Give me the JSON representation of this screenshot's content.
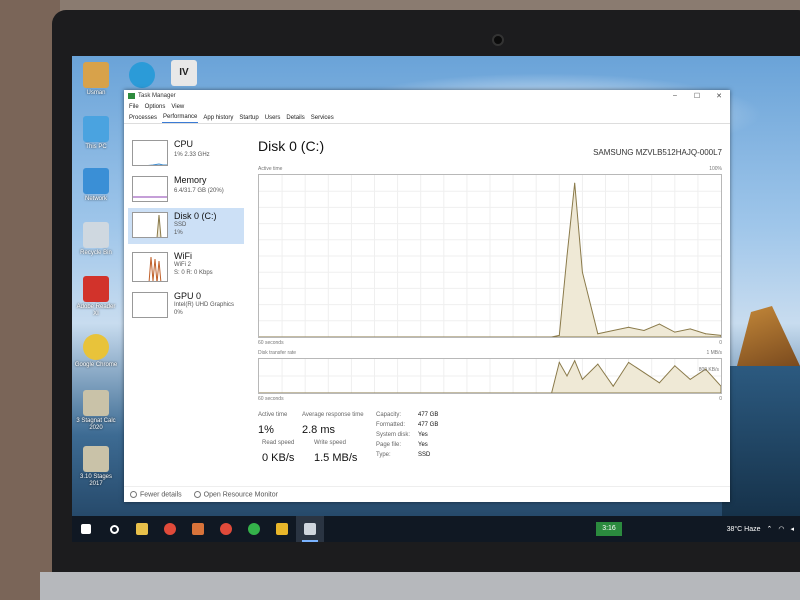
{
  "window": {
    "title": "Task Manager",
    "controls": [
      "–",
      "☐",
      "✕"
    ]
  },
  "menu": [
    "File",
    "Options",
    "View"
  ],
  "tabs": [
    "Processes",
    "Performance",
    "App history",
    "Startup",
    "Users",
    "Details",
    "Services"
  ],
  "active_tab": "Performance",
  "sidebar": {
    "items": [
      {
        "name": "CPU",
        "sub1": "1% 2.33 GHz",
        "sub2": ""
      },
      {
        "name": "Memory",
        "sub1": "6.4/31.7 GB (20%)",
        "sub2": ""
      },
      {
        "name": "Disk 0 (C:)",
        "sub1": "SSD",
        "sub2": "1%"
      },
      {
        "name": "WiFi",
        "sub1": "WiFi 2",
        "sub2": "S: 0 R: 0 Kbps"
      },
      {
        "name": "GPU 0",
        "sub1": "Intel(R) UHD Graphics",
        "sub2": "0%"
      }
    ],
    "selected": "Disk 0 (C:)"
  },
  "main": {
    "title": "Disk 0 (C:)",
    "model": "SAMSUNG MZVLB512HAJQ-000L7",
    "graph1_label": "Active time",
    "graph1_max": "100%",
    "graph1_time": "60 seconds",
    "graph1_min": "0",
    "graph2_label": "Disk transfer rate",
    "graph2_max": "1 MB/s",
    "graph2_mid": "800 KB/s",
    "graph2_time": "60 seconds",
    "graph2_min": "0",
    "stats": {
      "active_time_label": "Active time",
      "active_time_value": "1%",
      "avg_response_label": "Average response time",
      "avg_response_value": "2.8 ms",
      "read_speed_label": "Read speed",
      "read_speed_value": "0 KB/s",
      "write_speed_label": "Write speed",
      "write_speed_value": "1.5 MB/s"
    },
    "info": [
      {
        "label": "Capacity:",
        "value": "477 GB"
      },
      {
        "label": "Formatted:",
        "value": "477 GB"
      },
      {
        "label": "System disk:",
        "value": "Yes"
      },
      {
        "label": "Page file:",
        "value": "Yes"
      },
      {
        "label": "Type:",
        "value": "SSD"
      }
    ]
  },
  "footer": {
    "fewer_details": "Fewer details",
    "open_monitor": "Open Resource Monitor"
  },
  "desktop_icons": [
    {
      "label": "Usman",
      "color": "#d8a24a"
    },
    {
      "label": "This PC",
      "color": "#4aa3e0"
    },
    {
      "label": "Network",
      "color": "#3a8fd6"
    },
    {
      "label": "Recycle Bin",
      "color": "#cfd8e0"
    },
    {
      "label": "Adobe Reader XI",
      "color": "#d2332b"
    },
    {
      "label": "Google Chrome",
      "color": "#e8c33a"
    },
    {
      "label": "3 Stagnat Calc 2020",
      "color": "#c9c2a8"
    },
    {
      "label": "3.10 Stages 2017",
      "color": "#c9c2a8"
    },
    {
      "label": "Microsoft Edge",
      "color": "#2b9bd8"
    },
    {
      "label": "IV",
      "color": "#e8e8e8"
    }
  ],
  "taskbar": {
    "clock": "3:16",
    "weather": "38°C  Haze",
    "icons": [
      "windows-start-icon",
      "search-icon",
      "file-explorer-icon",
      "chrome-icon",
      "media-icon",
      "chrome-icon",
      "whatsapp-icon",
      "app-icon",
      "task-manager-icon"
    ]
  },
  "colors": {
    "graph_line": "#8a7a4a",
    "graph_fill": "#efe9d6",
    "selected_bg": "#cce0f6",
    "taskbar": "#101823",
    "clock_bg": "#2b8a3e"
  },
  "chart_data": [
    {
      "type": "area",
      "title": "Active time",
      "ylim": [
        0,
        100
      ],
      "x": [
        0,
        5,
        10,
        15,
        20,
        25,
        30,
        35,
        38,
        39,
        40,
        41,
        42,
        44,
        46,
        48,
        50,
        52,
        54,
        56,
        58,
        60
      ],
      "values": [
        0,
        0,
        0,
        0,
        0,
        0,
        0,
        0,
        0,
        1,
        50,
        95,
        40,
        2,
        4,
        6,
        4,
        8,
        3,
        5,
        2,
        1
      ]
    },
    {
      "type": "area",
      "title": "Disk transfer rate",
      "ylim": [
        0,
        1
      ],
      "x": [
        0,
        10,
        20,
        30,
        38,
        39,
        40,
        41,
        42,
        44,
        46,
        48,
        50,
        52,
        54,
        56,
        58,
        60
      ],
      "values": [
        0,
        0,
        0,
        0,
        0,
        0.9,
        0.5,
        0.95,
        0.4,
        0.85,
        0.2,
        0.9,
        0.6,
        0.3,
        0.8,
        0.4,
        0.7,
        0.2
      ]
    }
  ]
}
